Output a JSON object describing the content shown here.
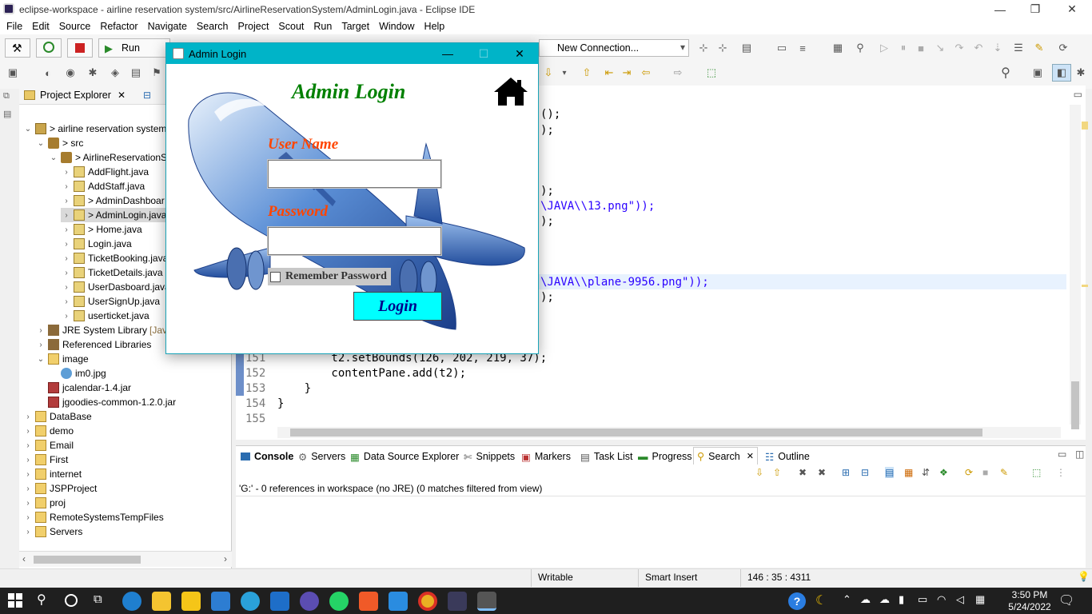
{
  "window": {
    "title": "eclipse-workspace - airline reservation system/src/AirlineReservationSystem/AdminLogin.java - Eclipse IDE",
    "minimize": "—",
    "restore": "❐",
    "close": "✕"
  },
  "menu": [
    "File",
    "Edit",
    "Source",
    "Refactor",
    "Navigate",
    "Search",
    "Project",
    "Scout",
    "Run",
    "Target",
    "Window",
    "Help"
  ],
  "toolbar": {
    "run_label": "Run",
    "connection_value": "New Connection...",
    "connection_caret": "▾"
  },
  "project_explorer": {
    "title": "Project Explorer",
    "items": [
      {
        "label": "> airline reservation system",
        "depth": 0,
        "twisty": "⌄",
        "icon": "proj"
      },
      {
        "label": "> src",
        "depth": 1,
        "twisty": "⌄",
        "icon": "pkg"
      },
      {
        "label": "> AirlineReservationS",
        "depth": 2,
        "twisty": "⌄",
        "icon": "pkg"
      },
      {
        "label": "AddFlight.java",
        "depth": 3,
        "twisty": "›",
        "icon": "java"
      },
      {
        "label": "AddStaff.java",
        "depth": 3,
        "twisty": "›",
        "icon": "java"
      },
      {
        "label": "> AdminDashboar",
        "depth": 3,
        "twisty": "›",
        "icon": "java"
      },
      {
        "label": "> AdminLogin.java",
        "depth": 3,
        "twisty": "›",
        "icon": "java",
        "selected": true
      },
      {
        "label": "> Home.java",
        "depth": 3,
        "twisty": "›",
        "icon": "java"
      },
      {
        "label": "Login.java",
        "depth": 3,
        "twisty": "›",
        "icon": "java"
      },
      {
        "label": "TicketBooking.java",
        "depth": 3,
        "twisty": "›",
        "icon": "java"
      },
      {
        "label": "TicketDetails.java",
        "depth": 3,
        "twisty": "›",
        "icon": "java"
      },
      {
        "label": "UserDasboard.java",
        "depth": 3,
        "twisty": "›",
        "icon": "java"
      },
      {
        "label": "UserSignUp.java",
        "depth": 3,
        "twisty": "›",
        "icon": "java"
      },
      {
        "label": "userticket.java",
        "depth": 3,
        "twisty": "›",
        "icon": "java"
      },
      {
        "label": "JRE System Library",
        "suffix": "[Java",
        "depth": 1,
        "twisty": "›",
        "icon": "lib"
      },
      {
        "label": "Referenced Libraries",
        "depth": 1,
        "twisty": "›",
        "icon": "lib"
      },
      {
        "label": "image",
        "depth": 1,
        "twisty": "⌄",
        "icon": "folder"
      },
      {
        "label": "im0.jpg",
        "depth": 2,
        "twisty": "",
        "icon": "img"
      },
      {
        "label": "jcalendar-1.4.jar",
        "depth": 1,
        "twisty": "",
        "icon": "jar"
      },
      {
        "label": "jgoodies-common-1.2.0.jar",
        "depth": 1,
        "twisty": "",
        "icon": "jar"
      },
      {
        "label": "DataBase",
        "depth": 0,
        "twisty": "›",
        "icon": "folder"
      },
      {
        "label": "demo",
        "depth": 0,
        "twisty": "›",
        "icon": "folder"
      },
      {
        "label": "Email",
        "depth": 0,
        "twisty": "›",
        "icon": "folder"
      },
      {
        "label": "First",
        "depth": 0,
        "twisty": "›",
        "icon": "folder"
      },
      {
        "label": "internet",
        "depth": 0,
        "twisty": "›",
        "icon": "folder"
      },
      {
        "label": "JSPProject",
        "depth": 0,
        "twisty": "›",
        "icon": "folder"
      },
      {
        "label": "proj",
        "depth": 0,
        "twisty": "›",
        "icon": "folder"
      },
      {
        "label": "RemoteSystemsTempFiles",
        "depth": 0,
        "twisty": "›",
        "icon": "folder"
      },
      {
        "label": "Servers",
        "depth": 0,
        "twisty": "›",
        "icon": "folder"
      }
    ]
  },
  "editor": {
    "lines": [
      {
        "num": "",
        "pre": "",
        "code": "    ();",
        "str": ""
      },
      {
        "num": "",
        "pre": "",
        "code": "    );",
        "str": ""
      },
      {
        "num": "",
        "pre": "",
        "code": "    );",
        "str": ""
      },
      {
        "num": "",
        "pre": "",
        "code": "",
        "str": "\\JAVA\\\\13.png\"));"
      },
      {
        "num": "",
        "pre": "",
        "code": "    );",
        "str": ""
      },
      {
        "num": "",
        "pre": "",
        "code": "",
        "str": "\\JAVA\\\\plane-9956.png\"));"
      },
      {
        "num": "",
        "pre": "",
        "code": "    );",
        "str": ""
      },
      {
        "num": "151",
        "code": "        t2.setBounds(126, 202, 219, 37);"
      },
      {
        "num": "152",
        "code": "        contentPane.add(t2);"
      },
      {
        "num": "153",
        "code": "    }"
      },
      {
        "num": "154",
        "code": "}"
      },
      {
        "num": "155",
        "code": ""
      }
    ],
    "partial": {
      "l1": "();",
      "l2": ");",
      "l3": ");",
      "l4_str": "\\JAVA\\\\13.png\"));",
      "l5": ");",
      "l6_str": "\\JAVA\\\\plane-9956.png\"));",
      "l7": ");",
      "top_frag": "  , {"
    }
  },
  "bottom_panel": {
    "tabs": [
      "Console",
      "Servers",
      "Data Source Explorer",
      "Snippets",
      "Markers",
      "Task List",
      "Progress",
      "Search",
      "Outline"
    ],
    "search_close": "✕",
    "result_text": "'G:' - 0 references in workspace (no JRE) (0 matches filtered from view)"
  },
  "status": {
    "writable": "Writable",
    "insert_mode": "Smart Insert",
    "position": "146 : 35 : 4311"
  },
  "taskbar": {
    "time": "3:50 PM",
    "date": "5/24/2022"
  },
  "dialog": {
    "title": "Admin Login",
    "heading": "Admin Login",
    "username_label": "User Name",
    "username_value": "",
    "password_label": "Password",
    "password_value": "",
    "remember_label": "Remember Password",
    "login_label": "Login",
    "colors": {
      "titlebar": "#00b4c8",
      "heading": "#008000",
      "labels": "#ff4500",
      "login_bg": "#00ffff",
      "login_text": "#00008b"
    }
  }
}
